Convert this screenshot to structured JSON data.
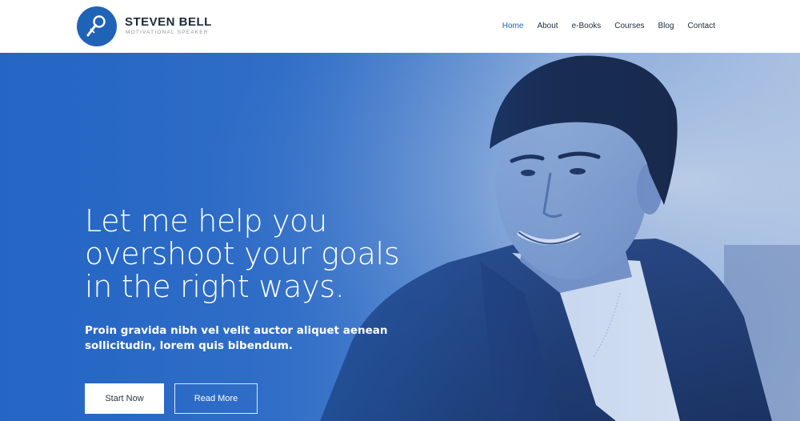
{
  "brand": {
    "name": "STEVEN BELL",
    "tagline": "MOTIVATIONAL SPEAKER",
    "logo_icon": "microphone-icon",
    "logo_color": "#1f63b7"
  },
  "nav": {
    "items": [
      {
        "label": "Home",
        "active": true
      },
      {
        "label": "About",
        "active": false
      },
      {
        "label": "e-Books",
        "active": false
      },
      {
        "label": "Courses",
        "active": false
      },
      {
        "label": "Blog",
        "active": false
      },
      {
        "label": "Contact",
        "active": false
      }
    ],
    "active_color": "#1f63b7"
  },
  "hero": {
    "heading_lines": [
      "Let me help you",
      "overshoot your goals",
      "in the right ways."
    ],
    "subtext_lines": [
      "Proin gravida nibh vel velit auctor aliquet aenean",
      "sollicitudin, lorem quis bibendum."
    ],
    "primary_button": "Start Now",
    "secondary_button": "Read More",
    "tint_color": "#2b6cc6"
  }
}
